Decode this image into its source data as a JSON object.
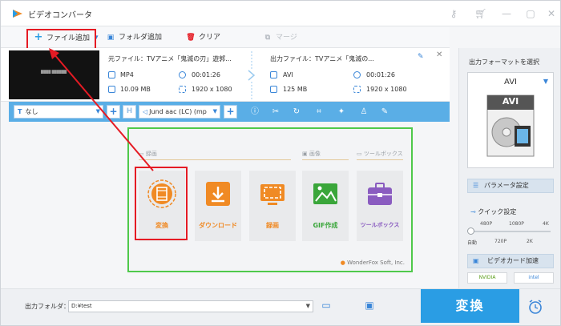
{
  "window": {
    "title": "ビデオコンバータ"
  },
  "toolbar": {
    "add_file": "ファイル追加",
    "add_folder": "フォルダ追加",
    "clear": "クリア",
    "merge": "マージ"
  },
  "file": {
    "source_file": "元ファイル：TVアニメ「鬼滅の刃」遊郭...",
    "source_format": "MP4",
    "source_duration": "00:01:26",
    "source_size": "10.09 MB",
    "source_resolution": "1920 x 1080",
    "output_file": "出力ファイル：TVアニメ「鬼滅の...",
    "output_format": "AVI",
    "output_duration": "00:01:26",
    "output_size": "125 MB",
    "output_resolution": "1920 x 1080"
  },
  "options": {
    "subtitle_value": "なし",
    "audio_value": "Jund aac (LC) (mp"
  },
  "popup": {
    "section_record": "録画",
    "section_image": "画像",
    "section_toolbox": "ツールボックス",
    "cards": [
      {
        "label": "変換",
        "color": "#f08a24"
      },
      {
        "label": "ダウンロード",
        "color": "#f08a24"
      },
      {
        "label": "録画",
        "color": "#f08a24"
      },
      {
        "label": "GIF作成",
        "color": "#3aa63a"
      },
      {
        "label": "ツールボックス",
        "color": "#8a5cc0"
      }
    ],
    "brand": "WonderFox Soft, Inc."
  },
  "right_panel": {
    "title": "出力フォーマットを選択",
    "format_name": "AVI",
    "format_icon_text": "AVI",
    "param_button": "パラメータ設定",
    "quick_label": "クイック設定",
    "quick_ticks_top": [
      "480P",
      "1080P",
      "4K"
    ],
    "quick_ticks_bottom": [
      "自動",
      "720P",
      "2K"
    ],
    "gpu_button": "ビデオカード加速",
    "gpu_nvidia": "NVIDIA",
    "gpu_intel": "intel"
  },
  "bottom": {
    "output_folder_label": "出力フォルダ：",
    "output_folder_value": "D:¥test",
    "convert_button": "変換"
  },
  "colors": {
    "accent": "#2a9de4",
    "options_bar": "#5aaee6",
    "highlight_red": "#e51b24",
    "popup_border": "#4fc94b"
  }
}
